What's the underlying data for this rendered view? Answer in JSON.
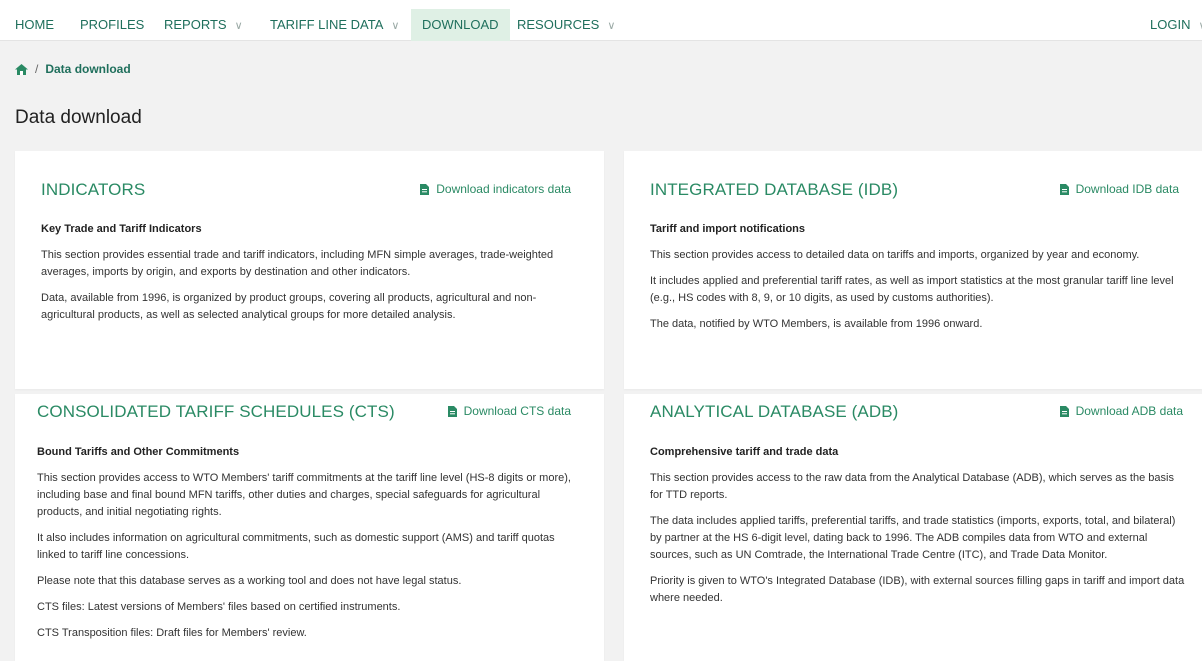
{
  "nav": {
    "home": "HOME",
    "profiles": "PROFILES",
    "reports": "REPORTS",
    "tariff_line_data": "TARIFF LINE DATA",
    "download": "DOWNLOAD",
    "resources": "RESOURCES",
    "login": "LOGIN"
  },
  "breadcrumb": {
    "current": "Data download",
    "separator": "/"
  },
  "page_title": "Data download",
  "cards": {
    "indicators": {
      "title": "INDICATORS",
      "link": "Download indicators data",
      "subtitle": "Key Trade and Tariff Indicators",
      "paragraphs": [
        "This section provides essential trade and tariff indicators, including MFN simple averages, trade-weighted averages, imports by origin, and exports by destination and other indicators.",
        "Data, available from 1996, is organized by product groups, covering all products, agricultural and non-agricultural products, as well as selected analytical groups for more detailed analysis."
      ]
    },
    "idb": {
      "title": "INTEGRATED DATABASE (IDB)",
      "link": "Download IDB data",
      "subtitle": "Tariff and import notifications",
      "paragraphs": [
        "This section provides access to detailed data on tariffs and imports, organized by year and economy.",
        "It includes applied and preferential tariff rates, as well as import statistics at the most granular tariff line level (e.g., HS codes with 8, 9, or 10 digits, as used by customs authorities).",
        "The data, notified by WTO Members, is available from 1996 onward."
      ]
    },
    "cts": {
      "title": "CONSOLIDATED TARIFF SCHEDULES (CTS)",
      "link": "Download CTS data",
      "subtitle": "Bound Tariffs and Other Commitments",
      "paragraphs": [
        "This section provides access to WTO Members' tariff commitments at the tariff line level (HS-8 digits or more), including base and final bound MFN tariffs, other duties and charges, special safeguards for agricultural products, and initial negotiating rights.",
        "It also includes information on agricultural commitments, such as domestic support (AMS) and tariff quotas linked to tariff line concessions.",
        "Please note that this database serves as a working tool and does not have legal status.",
        "CTS files: Latest versions of Members' files based on certified instruments.",
        "CTS Transposition files: Draft files for Members' review."
      ]
    },
    "adb": {
      "title": "ANALYTICAL DATABASE (ADB)",
      "link": "Download ADB data",
      "subtitle": "Comprehensive tariff and trade data",
      "paragraphs": [
        "This section provides access to the raw data from the Analytical Database (ADB), which serves as the basis for TTD reports.",
        "The data includes applied tariffs, preferential tariffs, and trade statistics (imports, exports, total, and bilateral) by partner at the HS 6-digit level, dating back to 1996. The ADB compiles data from WTO and external sources, such as UN Comtrade, the International Trade Centre (ITC), and Trade Data Monitor.",
        "Priority is given to WTO's Integrated Database (IDB), with external sources filling gaps in tariff and import data where needed."
      ]
    }
  },
  "colors": {
    "accent": "#2a8a64",
    "nav_active_bg": "#dff0e5",
    "page_bg": "#f2f2f2"
  }
}
